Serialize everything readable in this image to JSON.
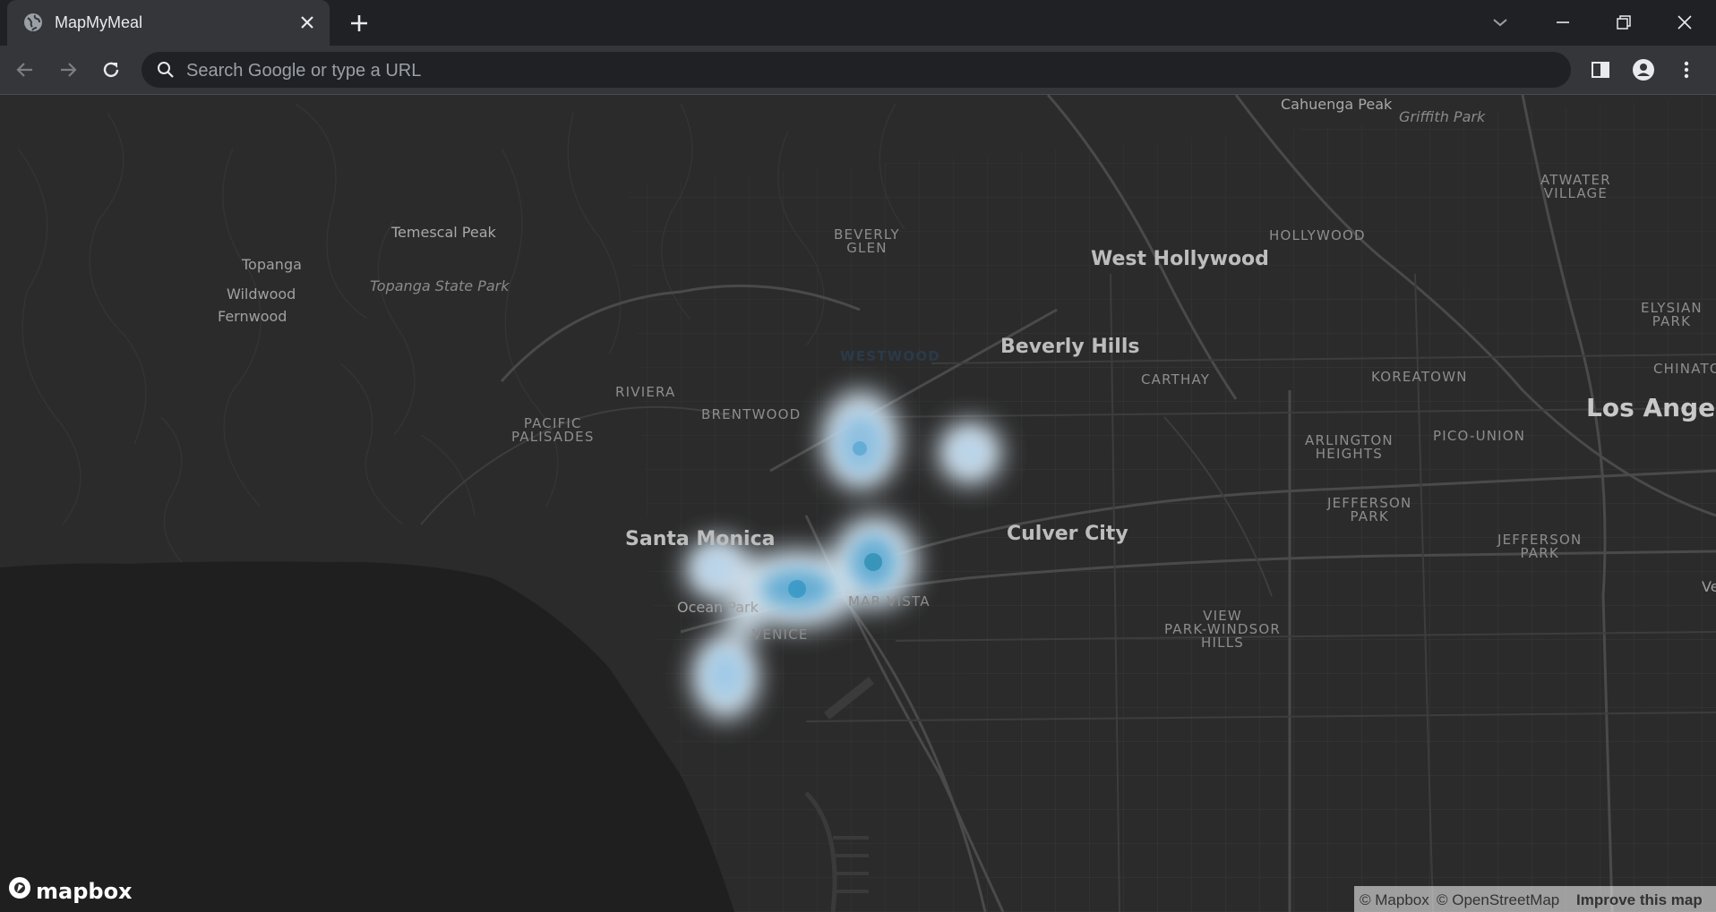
{
  "browser": {
    "tab_title": "MapMyMeal",
    "address_placeholder": "Search Google or type a URL"
  },
  "map": {
    "labels": {
      "cahuenga_peak": "Cahuenga Peak",
      "griffith_park": "Griffith Park",
      "atwater_village": "ATWATER\nVILLAGE",
      "beverly_glen": "BEVERLY\nGLEN",
      "temescal_peak": "Temescal Peak",
      "hollywood": "HOLLYWOOD",
      "west_hollywood": "West Hollywood",
      "topanga": "Topanga",
      "wildwood": "Wildwood",
      "fernwood": "Fernwood",
      "topanga_state_park": "Topanga State Park",
      "elysian_park": "ELYSIAN\nPARK",
      "westwood": "WESTWOOD",
      "beverly_hills": "Beverly Hills",
      "carthay": "CARTHAY",
      "koreatown": "KOREATOWN",
      "chinatown": "CHINATOW",
      "riviera": "RIVIERA",
      "brentwood": "BRENTWOOD",
      "los_angeles": "Los Angele",
      "pacific_palisades": "PACIFIC\nPALISADES",
      "arlington_heights": "ARLINGTON\nHEIGHTS",
      "pico_union": "PICO-UNION",
      "jefferson_park_1": "JEFFERSON\nPARK",
      "santa_monica": "Santa Monica",
      "culver_city": "Culver City",
      "jefferson_park_2": "JEFFERSON\nPARK",
      "ve": "Ve",
      "mar_vista": "MAR VISTA",
      "ocean_park": "Ocean Park",
      "venice": "VENICE",
      "view_park": "VIEW\nPARK-WINDSOR\nHILLS"
    },
    "logo_text": "mapbox",
    "attribution": {
      "mapbox": "© Mapbox",
      "osm": "© OpenStreetMap",
      "improve": "Improve this map"
    },
    "heat_color": "#4aa8d8"
  }
}
